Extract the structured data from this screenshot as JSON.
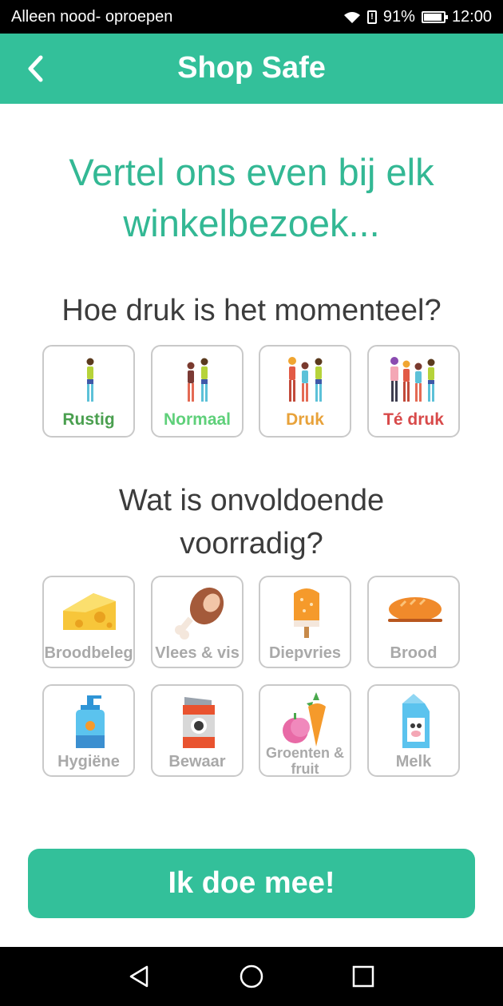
{
  "status_bar": {
    "carrier": "Alleen nood- oproepen",
    "alert": "!",
    "battery": "91%",
    "battery_level": 0.91,
    "time": "12:00"
  },
  "app_bar": {
    "title": "Shop Safe",
    "back_icon": "chevron-left-icon",
    "color": "#33c09a"
  },
  "headline": "Vertel ons even bij elk winkelbezoek...",
  "crowd_section": {
    "question": "Hoe druk is het momenteel?",
    "options": [
      {
        "label": "Rustig",
        "color": "#4a9f4f",
        "icon": "one-person-icon"
      },
      {
        "label": "Normaal",
        "color": "#5fd07a",
        "icon": "two-people-icon"
      },
      {
        "label": "Druk",
        "color": "#e8a23a",
        "icon": "three-people-icon"
      },
      {
        "label": "Té druk",
        "color": "#d84a4a",
        "icon": "crowd-icon"
      }
    ]
  },
  "stock_section": {
    "question": "Wat is onvoldoende voorradig?",
    "options": [
      {
        "label": "Broodbeleg",
        "icon": "cheese-icon"
      },
      {
        "label": "Vlees & vis",
        "icon": "meat-icon"
      },
      {
        "label": "Diepvries",
        "icon": "popsicle-icon"
      },
      {
        "label": "Brood",
        "icon": "bread-icon"
      },
      {
        "label": "Hygiëne",
        "icon": "soap-dispenser-icon"
      },
      {
        "label": "Bewaar",
        "icon": "canned-food-icon"
      },
      {
        "label": "Groenten & fruit",
        "icon": "fruit-vegetable-icon"
      },
      {
        "label": "Melk",
        "icon": "milk-carton-icon"
      }
    ]
  },
  "cta": {
    "label": "Ik doe mee!"
  },
  "nav_bar": {
    "icons": [
      "back-triangle-icon",
      "home-circle-icon",
      "recents-square-icon"
    ]
  }
}
